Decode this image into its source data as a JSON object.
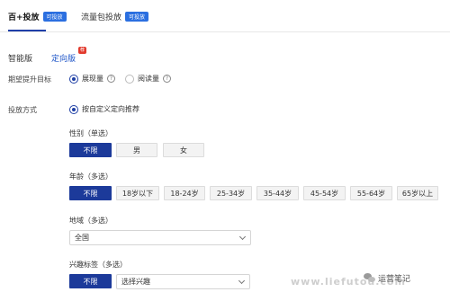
{
  "top_tabs": [
    {
      "label": "百+投放",
      "badge": "可投放"
    },
    {
      "label": "流量包投放",
      "badge": "可投放"
    }
  ],
  "sub_tabs": [
    {
      "label": "智能版"
    },
    {
      "label": "定向版",
      "badge": "荐"
    }
  ],
  "goal": {
    "label": "期望提升目标",
    "options": [
      {
        "label": "展现量",
        "checked": true
      },
      {
        "label": "阅读量",
        "checked": false
      }
    ],
    "help": "?"
  },
  "method": {
    "label": "投放方式",
    "option": "按自定义定向推荐"
  },
  "gender": {
    "title": "性别（单选）",
    "options": [
      "不限",
      "男",
      "女"
    ],
    "selected": "不限"
  },
  "age": {
    "title": "年龄（多选）",
    "options": [
      "不限",
      "18岁以下",
      "18-24岁",
      "25-34岁",
      "35-44岁",
      "45-54岁",
      "55-64岁",
      "65岁以上"
    ],
    "selected": "不限"
  },
  "region": {
    "title": "地域（多选）",
    "value": "全国"
  },
  "interest": {
    "title": "兴趣标签（多选）",
    "unlimited": "不限",
    "placeholder": "选择兴趣"
  },
  "watermark": "www.liefutou.com",
  "wechat_label": "运营笔记"
}
